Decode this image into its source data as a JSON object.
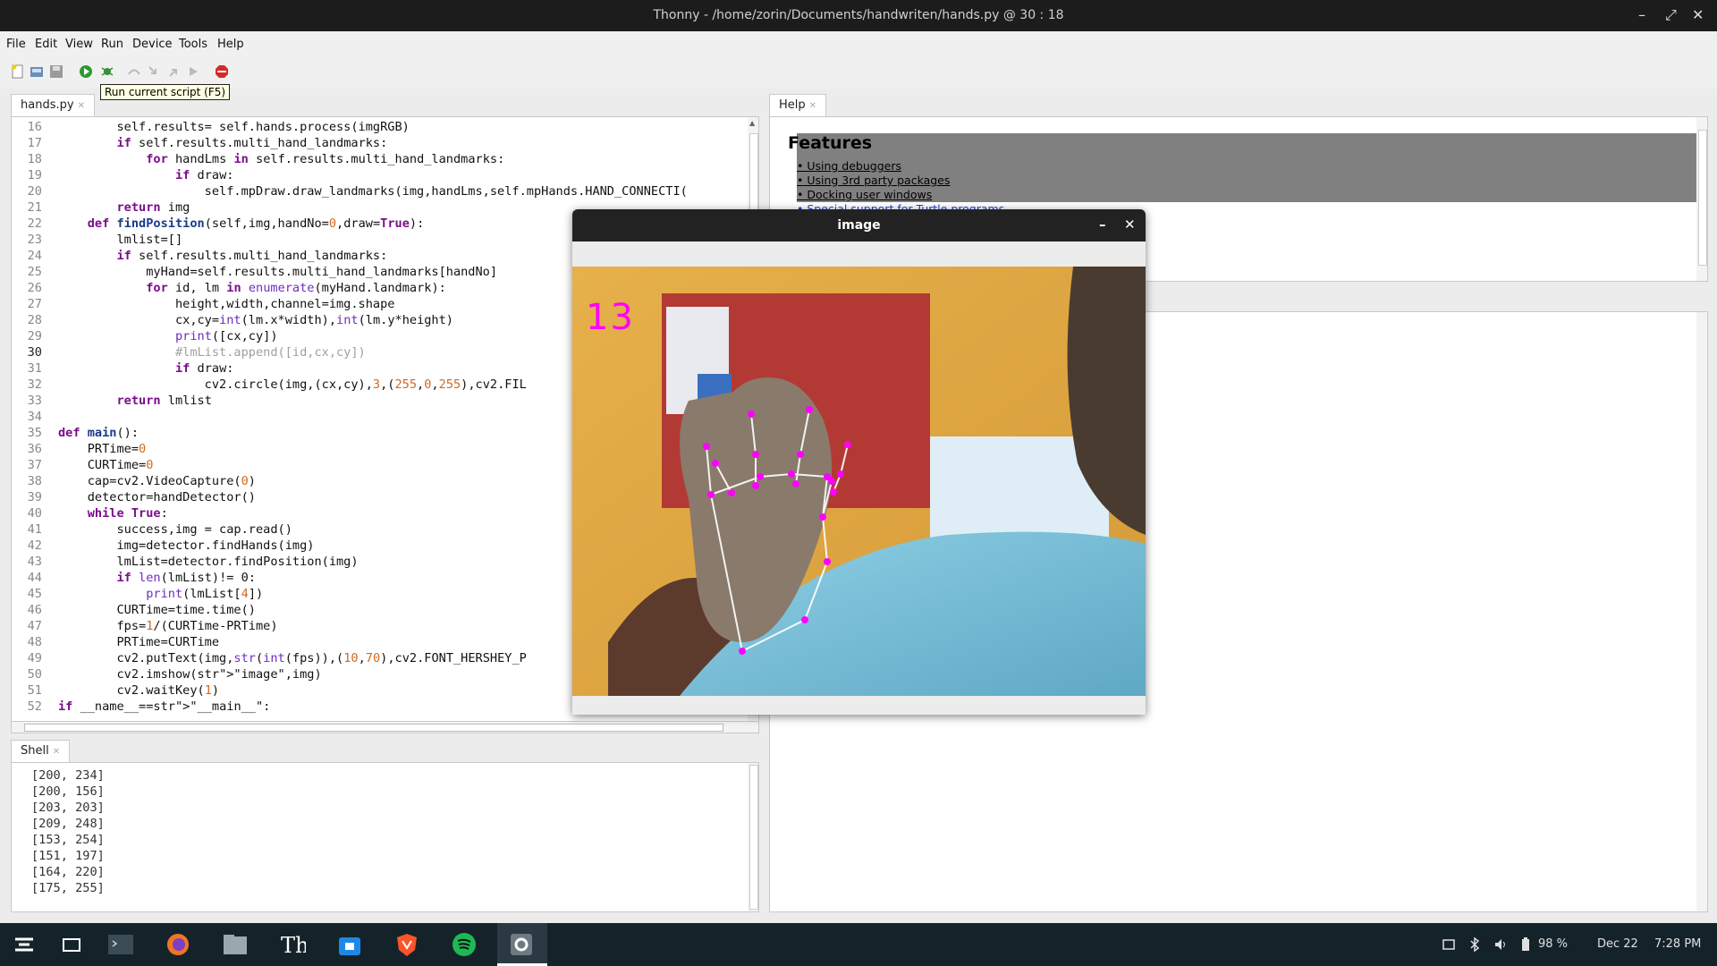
{
  "window": {
    "title": "Thonny  -  /home/zorin/Documents/handwriten/hands.py  @  30 : 18"
  },
  "menu": [
    "File",
    "Edit",
    "View",
    "Run",
    "Device",
    "Tools",
    "Help"
  ],
  "toolbar": {
    "tooltip": "Run current script (F5)"
  },
  "editor": {
    "tab": "hands.py",
    "lines": [
      {
        "n": "16",
        "code": "        self.results= self.hands.process(imgRGB)"
      },
      {
        "n": "17",
        "code": "        if self.results.multi_hand_landmarks:"
      },
      {
        "n": "18",
        "code": "            for handLms in self.results.multi_hand_landmarks:"
      },
      {
        "n": "19",
        "code": "                if draw:"
      },
      {
        "n": "20",
        "code": "                    self.mpDraw.draw_landmarks(img,handLms,self.mpHands.HAND_CONNECTI("
      },
      {
        "n": "21",
        "code": "        return img"
      },
      {
        "n": "22",
        "code": "    def findPosition(self,img,handNo=0,draw=True):"
      },
      {
        "n": "23",
        "code": "        lmlist=[]"
      },
      {
        "n": "24",
        "code": "        if self.results.multi_hand_landmarks:"
      },
      {
        "n": "25",
        "code": "            myHand=self.results.multi_hand_landmarks[handNo]"
      },
      {
        "n": "26",
        "code": "            for id, lm in enumerate(myHand.landmark):"
      },
      {
        "n": "27",
        "code": "                height,width,channel=img.shape"
      },
      {
        "n": "28",
        "code": "                cx,cy=int(lm.x*width),int(lm.y*height)"
      },
      {
        "n": "29",
        "code": "                print([cx,cy])"
      },
      {
        "n": "30",
        "code": "                #lmList.append([id,cx,cy])"
      },
      {
        "n": "31",
        "code": "                if draw:"
      },
      {
        "n": "32",
        "code": "                    cv2.circle(img,(cx,cy),3,(255,0,255),cv2.FIL"
      },
      {
        "n": "33",
        "code": "        return lmlist"
      },
      {
        "n": "34",
        "code": ""
      },
      {
        "n": "35",
        "code": "def main():"
      },
      {
        "n": "36",
        "code": "    PRTime=0"
      },
      {
        "n": "37",
        "code": "    CURTime=0"
      },
      {
        "n": "38",
        "code": "    cap=cv2.VideoCapture(0)"
      },
      {
        "n": "39",
        "code": "    detector=handDetector()"
      },
      {
        "n": "40",
        "code": "    while True:"
      },
      {
        "n": "41",
        "code": "        success,img = cap.read()"
      },
      {
        "n": "42",
        "code": "        img=detector.findHands(img)"
      },
      {
        "n": "43",
        "code": "        lmList=detector.findPosition(img)"
      },
      {
        "n": "44",
        "code": "        if len(lmList)!= 0:"
      },
      {
        "n": "45",
        "code": "            print(lmList[4])"
      },
      {
        "n": "46",
        "code": "        CURTime=time.time()"
      },
      {
        "n": "47",
        "code": "        fps=1/(CURTime-PRTime)"
      },
      {
        "n": "48",
        "code": "        PRTime=CURTime"
      },
      {
        "n": "49",
        "code": "        cv2.putText(img,str(int(fps)),(10,70),cv2.FONT_HERSHEY_P"
      },
      {
        "n": "50",
        "code": "        cv2.imshow(\"image\",img)"
      },
      {
        "n": "51",
        "code": "        cv2.waitKey(1)"
      },
      {
        "n": "52",
        "code": "if __name__==\"__main__\":"
      }
    ]
  },
  "shell": {
    "tab": "Shell",
    "lines": [
      "[200, 234]",
      "[200, 156]",
      "[203, 203]",
      "[209, 248]",
      "[153, 254]",
      "[151, 197]",
      "[164, 220]",
      "[175, 255]"
    ]
  },
  "help": {
    "tab": "Help",
    "heading": "Features",
    "links": [
      "• Using debuggers",
      "• Using 3rd party packages",
      "• Docking user windows",
      "• Special support for Turtle programs"
    ]
  },
  "image_window": {
    "title": "image",
    "fps_text": "13"
  },
  "taskbar": {
    "apps": [
      "zorin-menu-icon",
      "desktop-icon",
      "terminal-icon",
      "firefox-icon",
      "files-icon",
      "thonny-icon",
      "software-store-icon",
      "brave-icon",
      "spotify-icon",
      "settings-icon"
    ],
    "battery": "98 %",
    "date": "Dec 22",
    "time": "7:28 PM"
  },
  "colors": {
    "accent": "#ff00ff",
    "titlebar": "#1c1c1c",
    "taskbar": "#14232a"
  }
}
